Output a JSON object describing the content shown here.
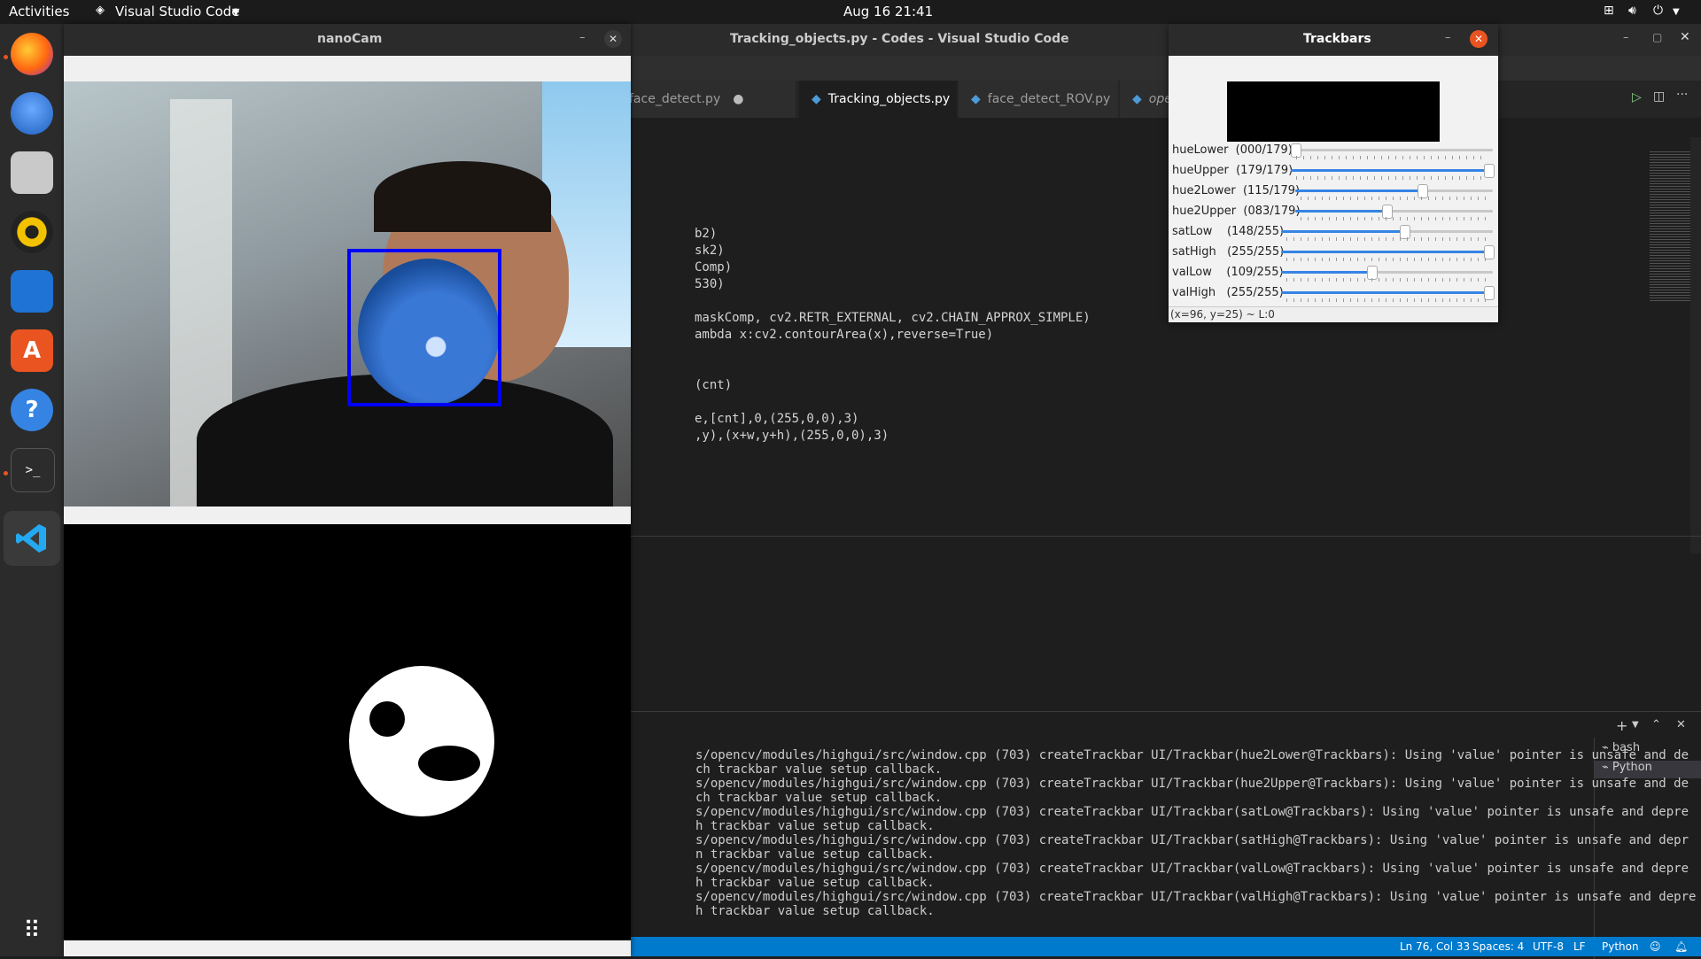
{
  "topbar": {
    "activities": "Activities",
    "app": "Visual Studio Code",
    "clock": "Aug 16  21:41"
  },
  "dock": {
    "icons": [
      "firefox-icon",
      "thunderbird-icon",
      "files-icon",
      "rhythmbox-icon",
      "writer-icon",
      "software-icon",
      "help-icon",
      "terminal-icon",
      "vscode-icon",
      "apps-grid-icon"
    ],
    "help_glyph": "?",
    "terminal_glyph": ">_"
  },
  "vscode": {
    "title": "Tracking_objects.py - Codes - Visual Studio Code",
    "tabs": [
      {
        "label": "face_detect.py",
        "modified": true
      },
      {
        "label": "Tracking_objects.py",
        "active": true
      },
      {
        "label": "face_detect_ROV.py"
      },
      {
        "label": "opencv.py",
        "italic": true
      }
    ],
    "code_lines": [
      "b2)",
      "sk2)",
      "Comp)",
      "530)",
      "",
      "maskComp, cv2.RETR_EXTERNAL, cv2.CHAIN_APPROX_SIMPLE)",
      "ambda x:cv2.contourArea(x),reverse=True)",
      "",
      "",
      "(cnt)",
      "",
      "e,[cnt],0,(255,0,0),3)",
      ",y),(x+w,y+h),(255,0,0),3)"
    ],
    "terminal_lines": [
      "s/opencv/modules/highgui/src/window.cpp (703) createTrackbar UI/Trackbar(hue2Lower@Trackbars): Using 'value' pointer is unsafe and de",
      "ch trackbar value setup callback.",
      "s/opencv/modules/highgui/src/window.cpp (703) createTrackbar UI/Trackbar(hue2Upper@Trackbars): Using 'value' pointer is unsafe and de",
      "ch trackbar value setup callback.",
      "s/opencv/modules/highgui/src/window.cpp (703) createTrackbar UI/Trackbar(satLow@Trackbars): Using 'value' pointer is unsafe and depre",
      "h trackbar value setup callback.",
      "s/opencv/modules/highgui/src/window.cpp (703) createTrackbar UI/Trackbar(satHigh@Trackbars): Using 'value' pointer is unsafe and depr",
      "n trackbar value setup callback.",
      "s/opencv/modules/highgui/src/window.cpp (703) createTrackbar UI/Trackbar(valLow@Trackbars): Using 'value' pointer is unsafe and depre",
      "h trackbar value setup callback.",
      "s/opencv/modules/highgui/src/window.cpp (703) createTrackbar UI/Trackbar(valHigh@Trackbars): Using 'value' pointer is unsafe and depre",
      "h trackbar value setup callback."
    ],
    "terminals": [
      "bash",
      "Python"
    ],
    "status": {
      "position": "Ln 76, Col 33",
      "spaces": "Spaces: 4",
      "encoding": "UTF-8",
      "eol": "LF",
      "language": "Python"
    }
  },
  "nanocam": {
    "title": "nanoCam"
  },
  "trackbars": {
    "title": "Trackbars",
    "sliders": [
      {
        "name": "hueLower",
        "label": "hueLower  (000/179)",
        "value": 0,
        "max": 179
      },
      {
        "name": "hueUpper",
        "label": "hueUpper  (179/179)",
        "value": 179,
        "max": 179
      },
      {
        "name": "hue2Lower",
        "label": "hue2Lower  (115/179)",
        "value": 115,
        "max": 179
      },
      {
        "name": "hue2Upper",
        "label": "hue2Upper  (083/179)",
        "value": 83,
        "max": 179
      },
      {
        "name": "satLow",
        "label": "satLow    (148/255)",
        "value": 148,
        "max": 255
      },
      {
        "name": "satHigh",
        "label": "satHigh   (255/255)",
        "value": 255,
        "max": 255
      },
      {
        "name": "valLow",
        "label": "valLow    (109/255)",
        "value": 109,
        "max": 255
      },
      {
        "name": "valHigh",
        "label": "valHigh   (255/255)",
        "value": 255,
        "max": 255
      }
    ],
    "footer": "(x=96, y=25) ~ L:0"
  },
  "colors": {
    "accent": "#007acc",
    "frame": "#0000ff",
    "ubuntu_orange": "#e95420"
  }
}
